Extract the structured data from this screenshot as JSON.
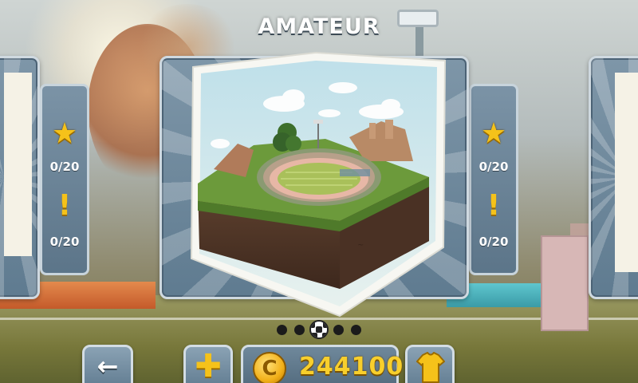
{
  "level": {
    "title": "AMATEUR"
  },
  "left_card": {
    "stars_progress": "0/20",
    "challenges_progress": "0/20"
  },
  "right_card": {
    "stars_progress": "0/20",
    "challenges_progress": "0/20"
  },
  "carousel": {
    "page_count": 5,
    "active_index": 2
  },
  "footer": {
    "coins": "244100",
    "coin_symbol": "C"
  },
  "icons": {
    "star": "star-icon",
    "challenge": "exclamation-icon",
    "back": "back-arrow-icon",
    "add": "plus-icon",
    "shop": "shirt-icon",
    "coin": "coin-icon"
  },
  "colors": {
    "accent_yellow": "#f5c21a",
    "panel_blue": "#6f889b",
    "text_white": "#ffffff"
  }
}
